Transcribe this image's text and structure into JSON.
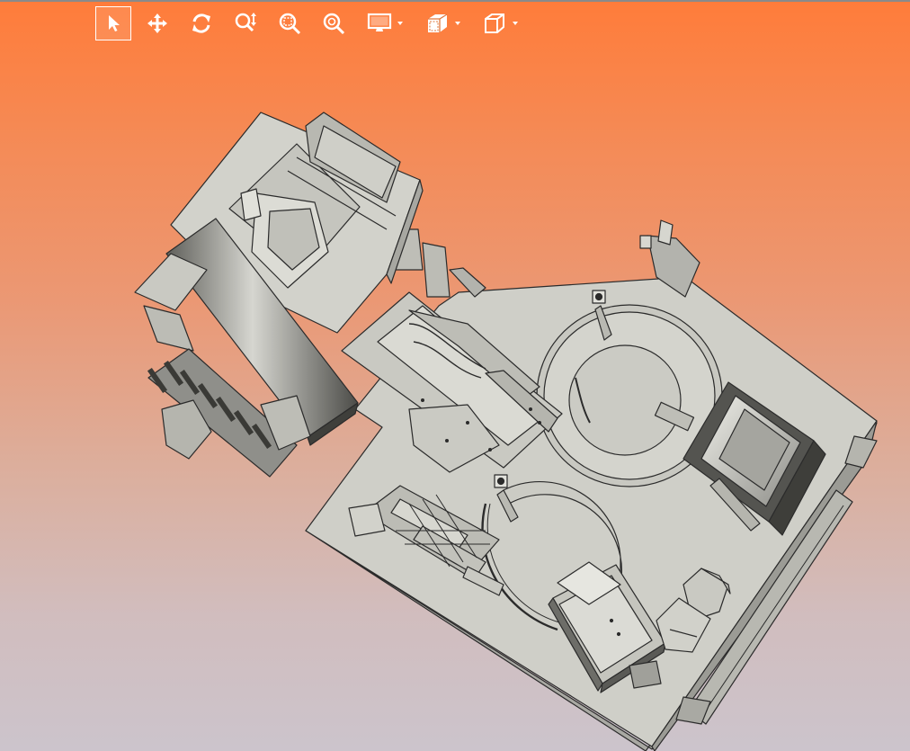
{
  "toolbar": {
    "tools": [
      {
        "name": "select",
        "icon": "cursor-arrow-icon",
        "active": true
      },
      {
        "name": "pan",
        "icon": "move-arrows-icon"
      },
      {
        "name": "rotate",
        "icon": "rotate-icon"
      },
      {
        "name": "zoom",
        "icon": "zoom-updown-icon"
      },
      {
        "name": "zoom-window",
        "icon": "zoom-window-icon"
      },
      {
        "name": "zoom-fit",
        "icon": "zoom-fit-icon"
      },
      {
        "name": "display-mode",
        "icon": "monitor-icon",
        "dropdown": true
      },
      {
        "name": "section-view",
        "icon": "section-cube-icon",
        "dropdown": true
      },
      {
        "name": "standard-views",
        "icon": "view-cube-icon",
        "dropdown": true
      }
    ]
  },
  "colors": {
    "background_top": "#ff7c3a",
    "background_bottom": "#ccc4cc",
    "model_face": "#cfcfc8",
    "model_edge": "#2b2b2b",
    "icon": "#ffffff"
  }
}
